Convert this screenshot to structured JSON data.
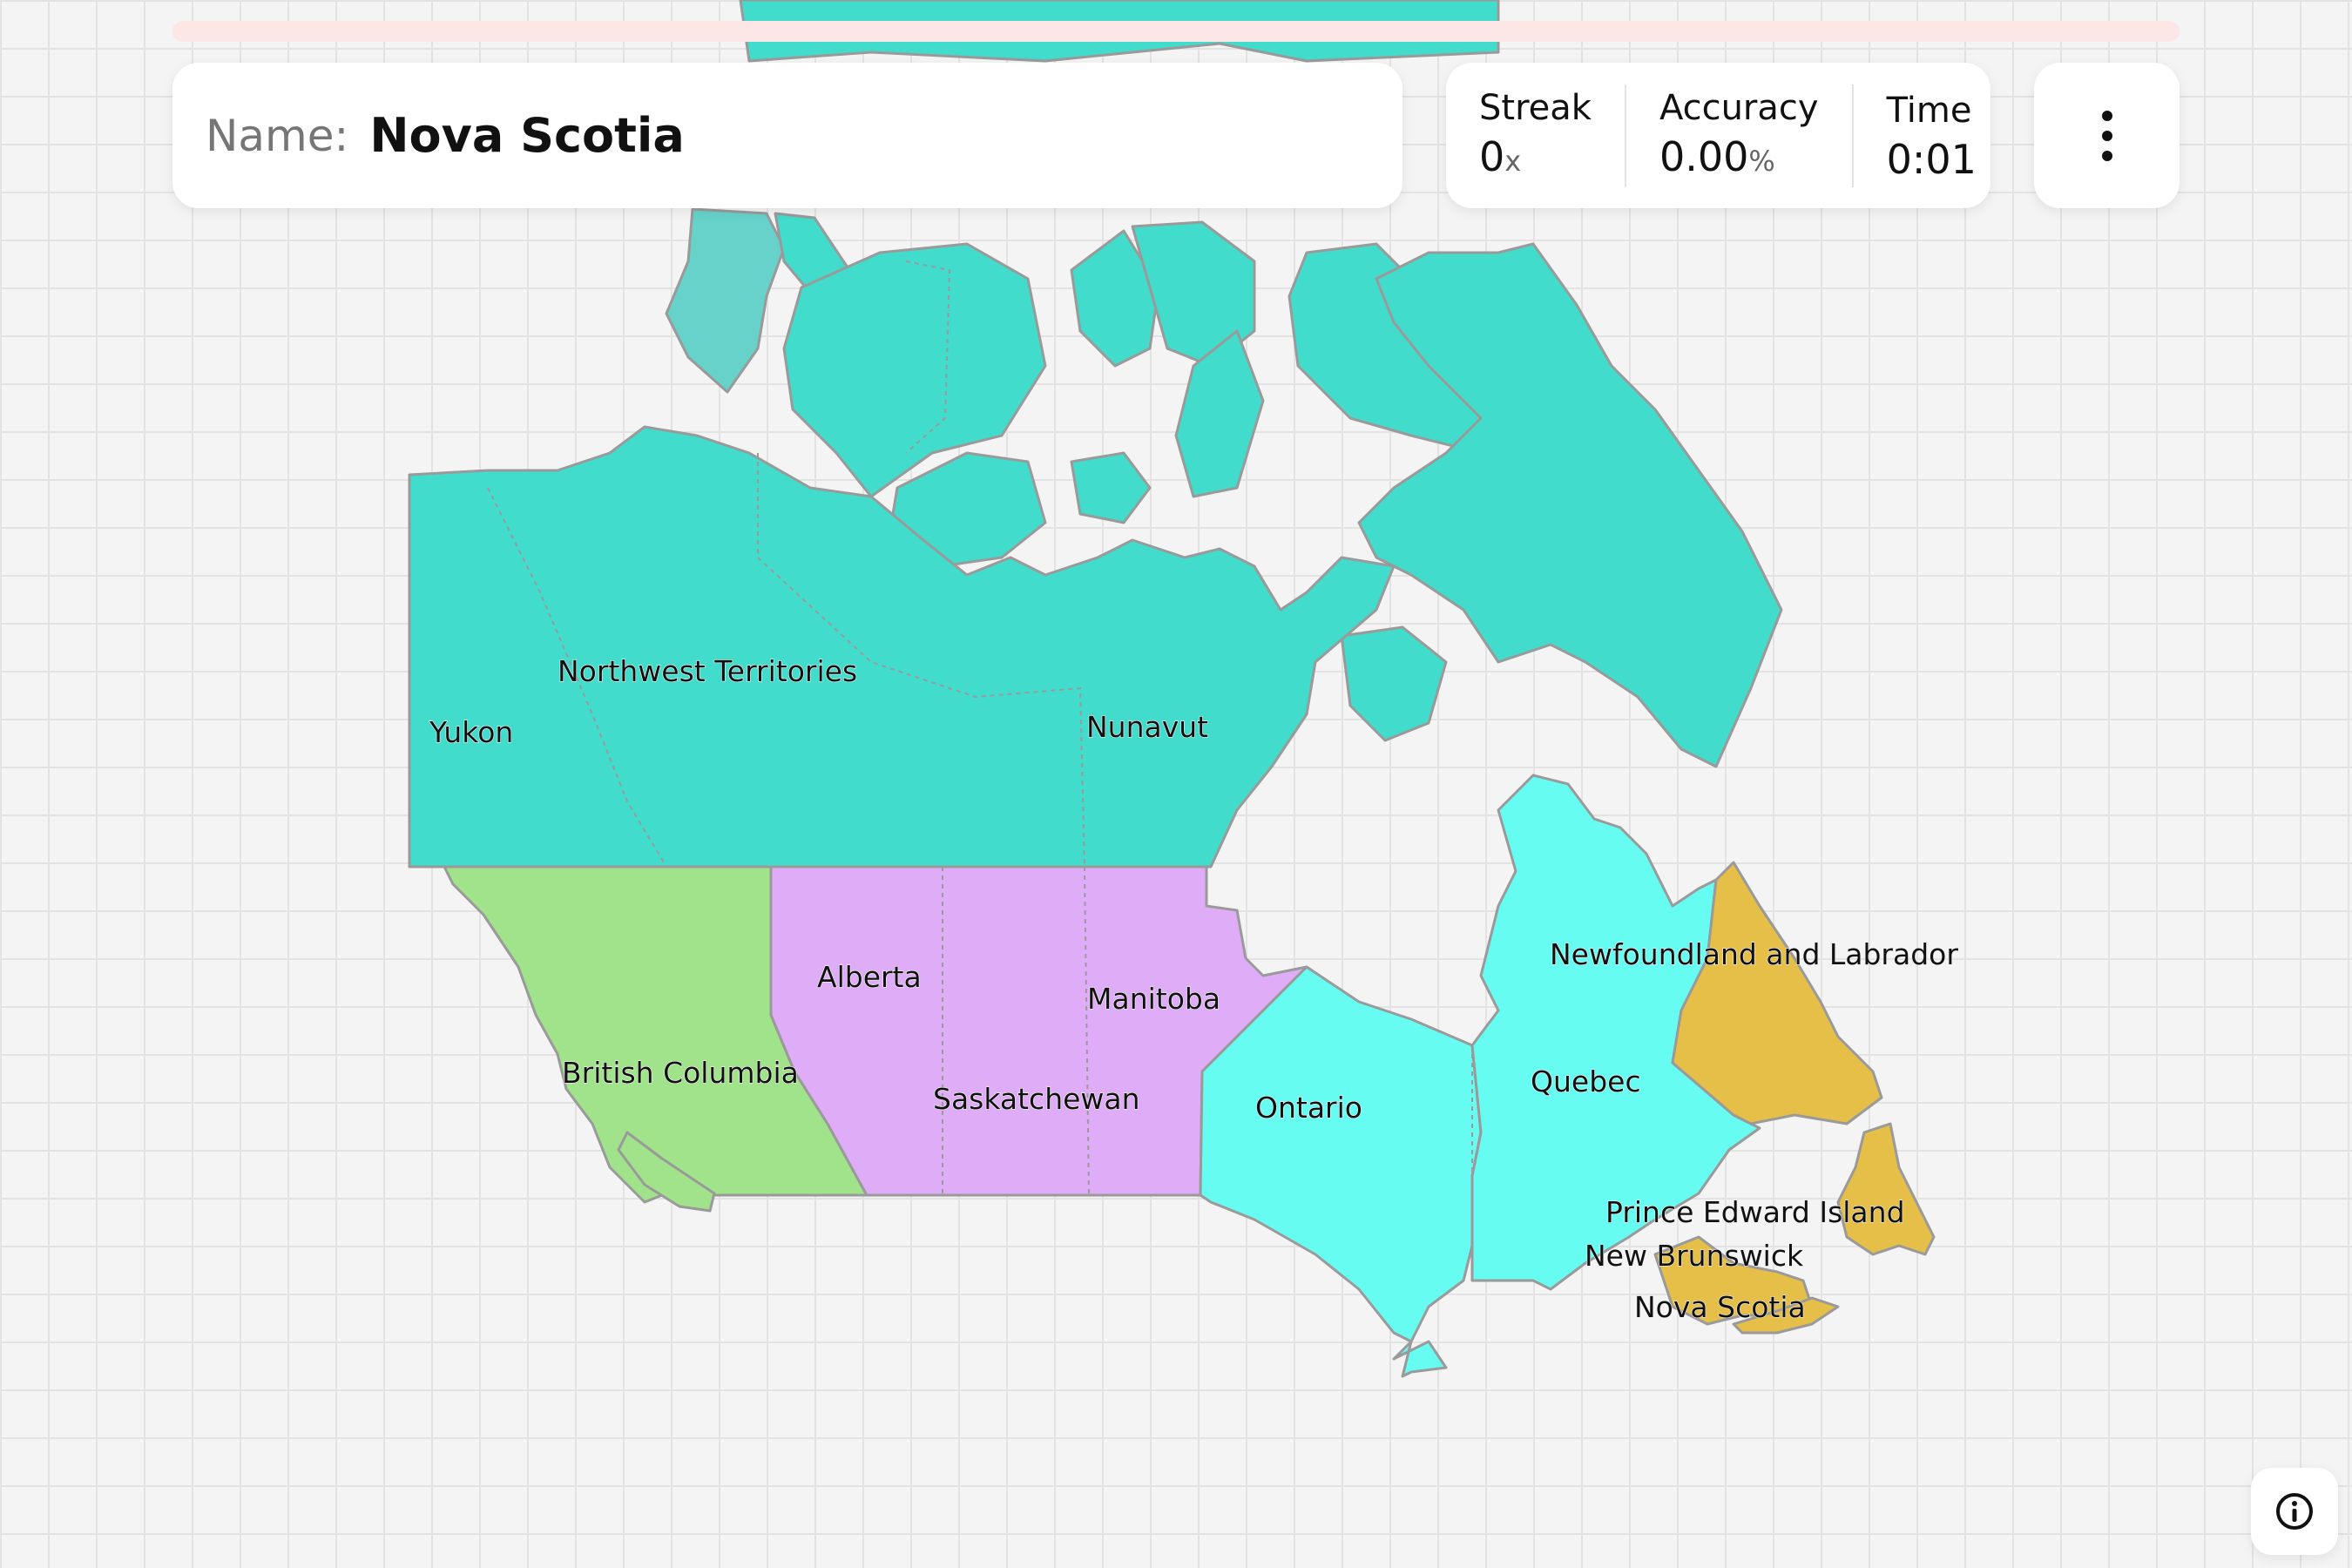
{
  "quiz": {
    "name_label": "Name:",
    "name_value": "Nova Scotia",
    "progress_fraction": 0.0
  },
  "stats": {
    "streak_label": "Streak",
    "streak_value": "0",
    "streak_unit": "x",
    "accuracy_label": "Accuracy",
    "accuracy_value": "0.00",
    "accuracy_unit": "%",
    "time_label": "Time",
    "time_value": "0:01"
  },
  "icons": {
    "menu": "more-vertical-icon",
    "info": "info-icon"
  },
  "colors": {
    "territories": "#41dccb",
    "british_columbia": "#a0e38a",
    "prairies": "#dfadf8",
    "central": "#66fcf2",
    "atlantic": "#e5bf47",
    "greenland": "#66d2ca",
    "progress_track": "#fde6e6"
  },
  "map": {
    "labels": {
      "yukon": "Yukon",
      "northwest_territories": "Northwest Territories",
      "nunavut": "Nunavut",
      "british_columbia": "British Columbia",
      "alberta": "Alberta",
      "saskatchewan": "Saskatchewan",
      "manitoba": "Manitoba",
      "ontario": "Ontario",
      "quebec": "Quebec",
      "newfoundland_and_labrador": "Newfoundland and Labrador",
      "prince_edward_island": "Prince Edward Island",
      "new_brunswick": "New Brunswick",
      "nova_scotia": "Nova Scotia"
    }
  }
}
